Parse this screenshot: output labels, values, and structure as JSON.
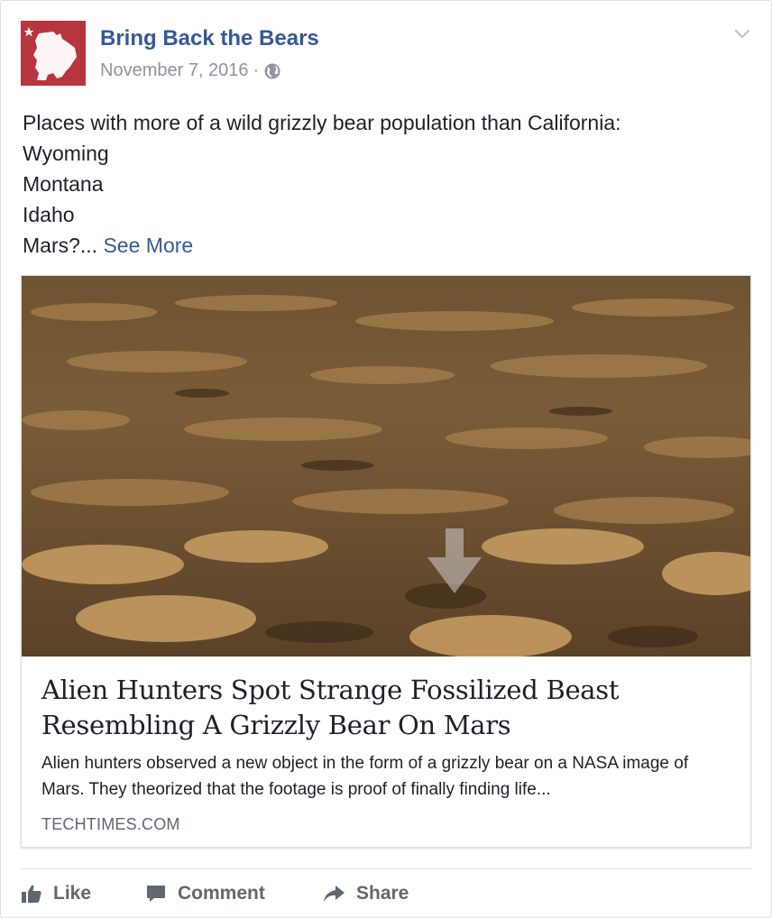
{
  "post": {
    "page_name": "Bring Back the Bears",
    "date": "November 7, 2016",
    "separator": "·",
    "privacy_icon": "globe-icon",
    "menu_icon": "chevron-down-icon",
    "text_lines": [
      "Places with more of a wild grizzly bear population than California:",
      "Wyoming",
      "Montana",
      "Idaho"
    ],
    "last_line": "Mars?...",
    "see_more": "See More"
  },
  "link": {
    "title": "Alien Hunters Spot Strange Fossilized Beast Resembling A Grizzly Bear On Mars",
    "description": "Alien hunters observed a new object in the form of a grizzly bear on a NASA image of Mars. They theorized that the footage is proof of finally finding life...",
    "domain": "TECHTIMES.COM"
  },
  "actions": {
    "like": "Like",
    "comment": "Comment",
    "share": "Share"
  },
  "colors": {
    "link_blue": "#365899",
    "brand_red": "#b8343f",
    "meta_gray": "#90949c",
    "action_gray": "#606770"
  }
}
